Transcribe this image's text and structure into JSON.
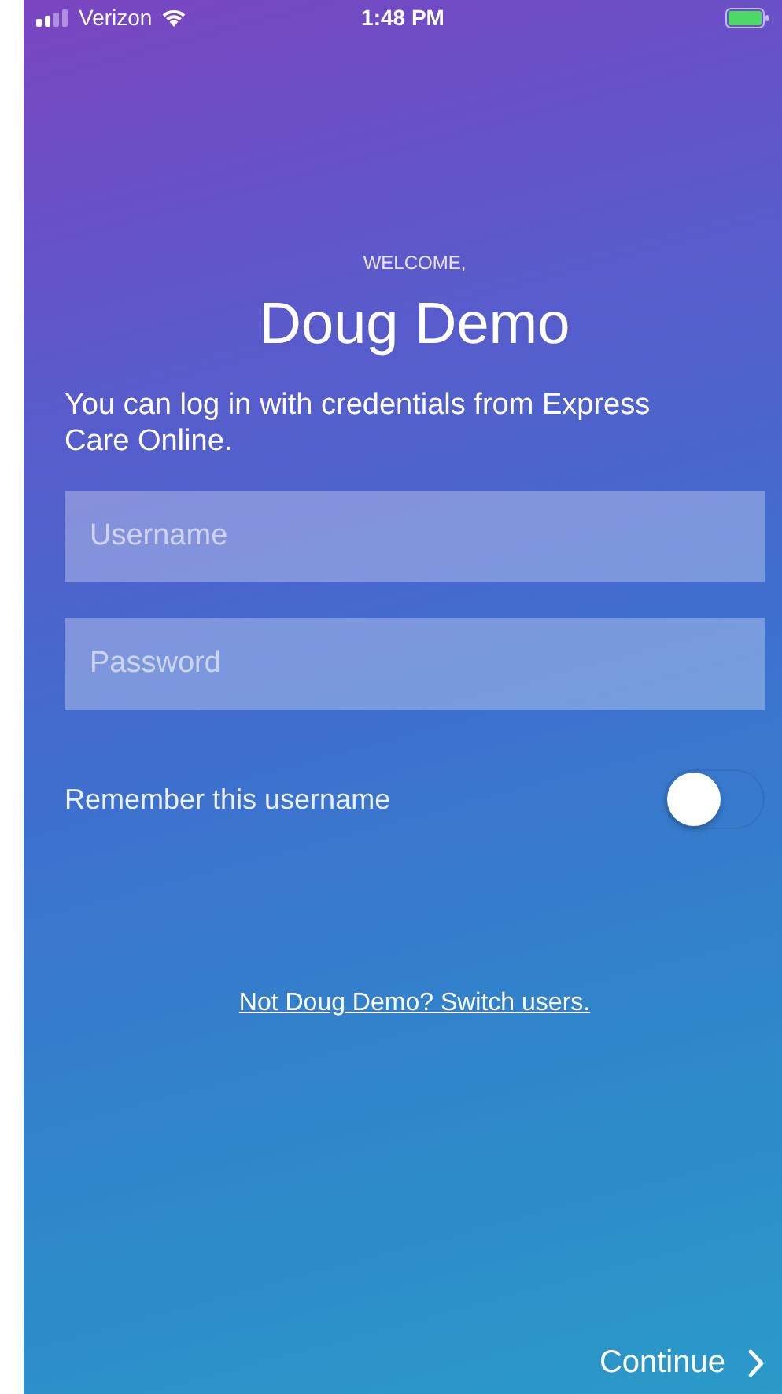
{
  "status_bar": {
    "carrier": "Verizon",
    "time": "1:48 PM"
  },
  "greeting": "WELCOME,",
  "user_name": "Doug Demo",
  "description": "You can log in with credentials from Express Care Online.",
  "fields": [
    {
      "placeholder": "Username"
    },
    {
      "placeholder": "Password"
    }
  ],
  "remember": {
    "label": "Remember this username",
    "on": false
  },
  "switch_link": "Not Doug Demo? Switch users.",
  "continue_button": "Continue"
}
